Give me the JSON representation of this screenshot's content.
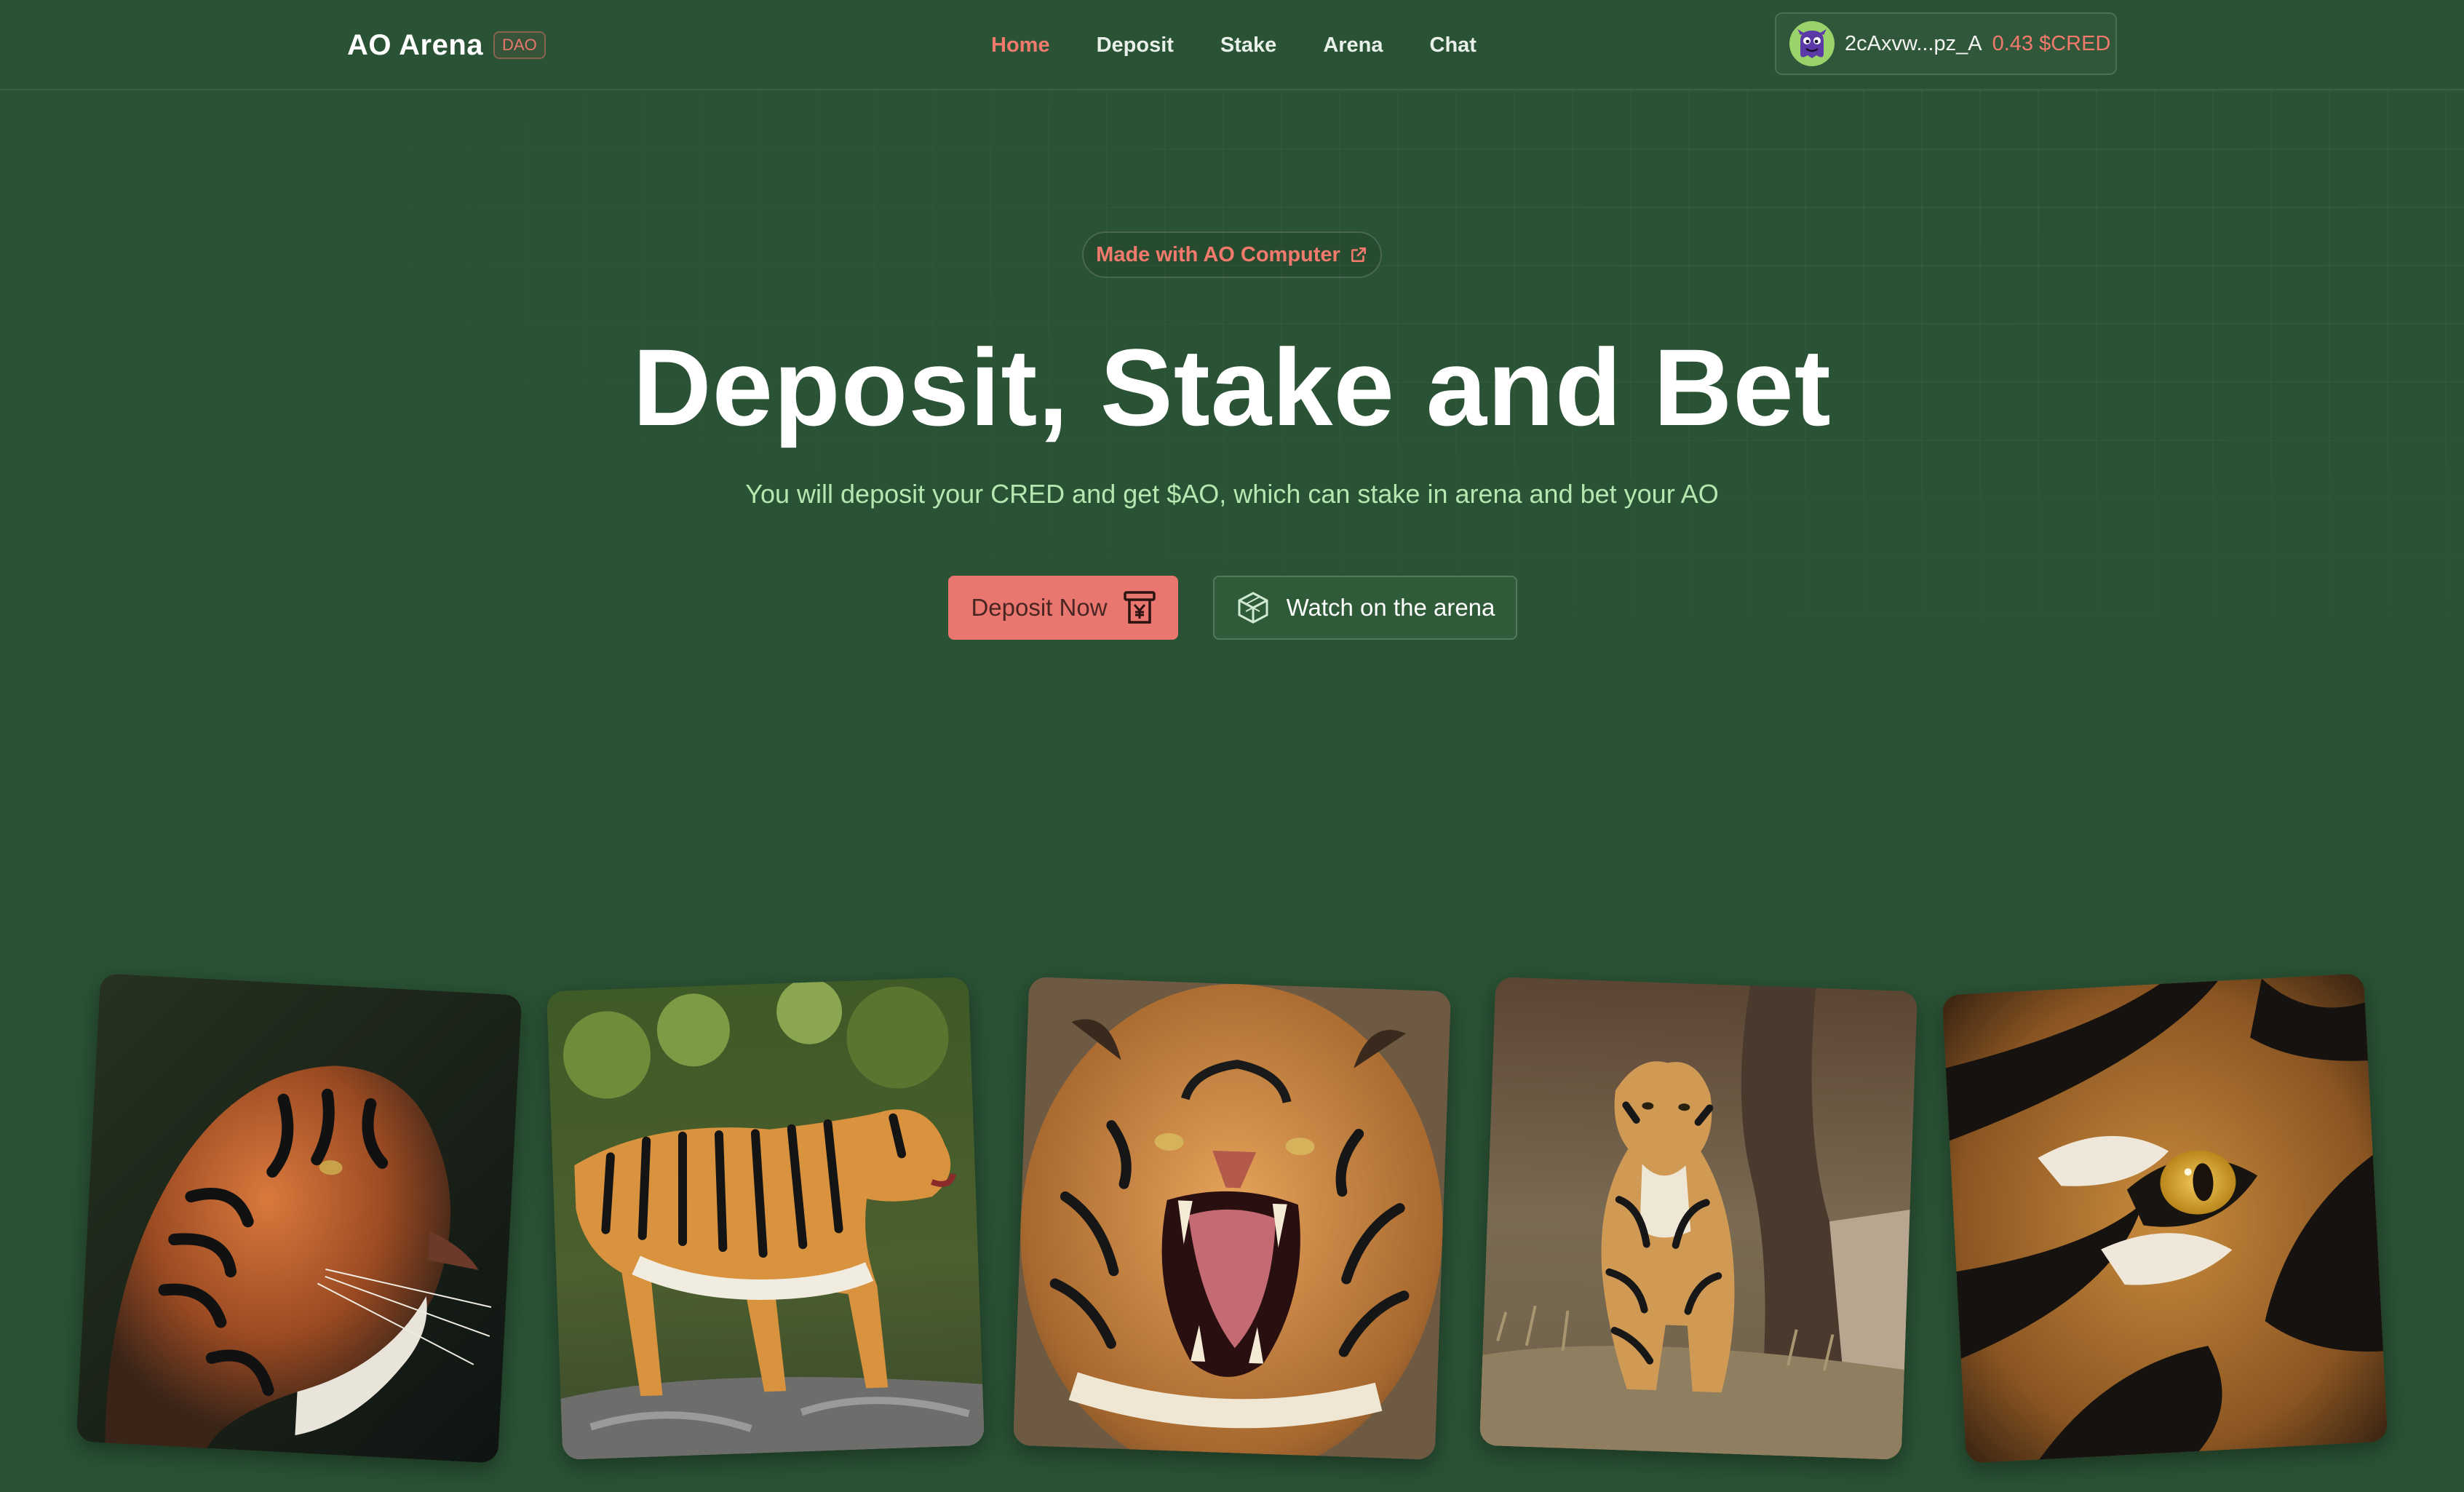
{
  "header": {
    "brand_title": "AO Arena",
    "brand_badge": "DAO",
    "nav": [
      {
        "label": "Home",
        "active": true
      },
      {
        "label": "Deposit",
        "active": false
      },
      {
        "label": "Stake",
        "active": false
      },
      {
        "label": "Arena",
        "active": false
      },
      {
        "label": "Chat",
        "active": false
      }
    ],
    "wallet": {
      "address": "2cAxvw...pz_A",
      "balance": "0.43 $CRED",
      "avatar_icon": "purple-monster-avatar"
    }
  },
  "hero": {
    "pill_label": "Made with AO Computer",
    "pill_icon": "external-link-icon",
    "title": "Deposit, Stake and Bet",
    "subtitle": "You will deposit your CRED and get $AO, which can stake in arena and bet your AO",
    "primary_button": {
      "label": "Deposit Now",
      "icon": "atm-yen-icon"
    },
    "secondary_button": {
      "label": "Watch on the arena",
      "icon": "arena-cube-icon"
    }
  },
  "gallery": [
    {
      "subject": "tiger-profile"
    },
    {
      "subject": "tiger-walking"
    },
    {
      "subject": "tiger-roaring"
    },
    {
      "subject": "tiger-sitting"
    },
    {
      "subject": "tiger-eye-closeup"
    }
  ],
  "colors": {
    "background": "#2a5234",
    "accent": "#f27a6d",
    "subtitle": "#b7e6b0",
    "primary_button": "#e9766f"
  }
}
